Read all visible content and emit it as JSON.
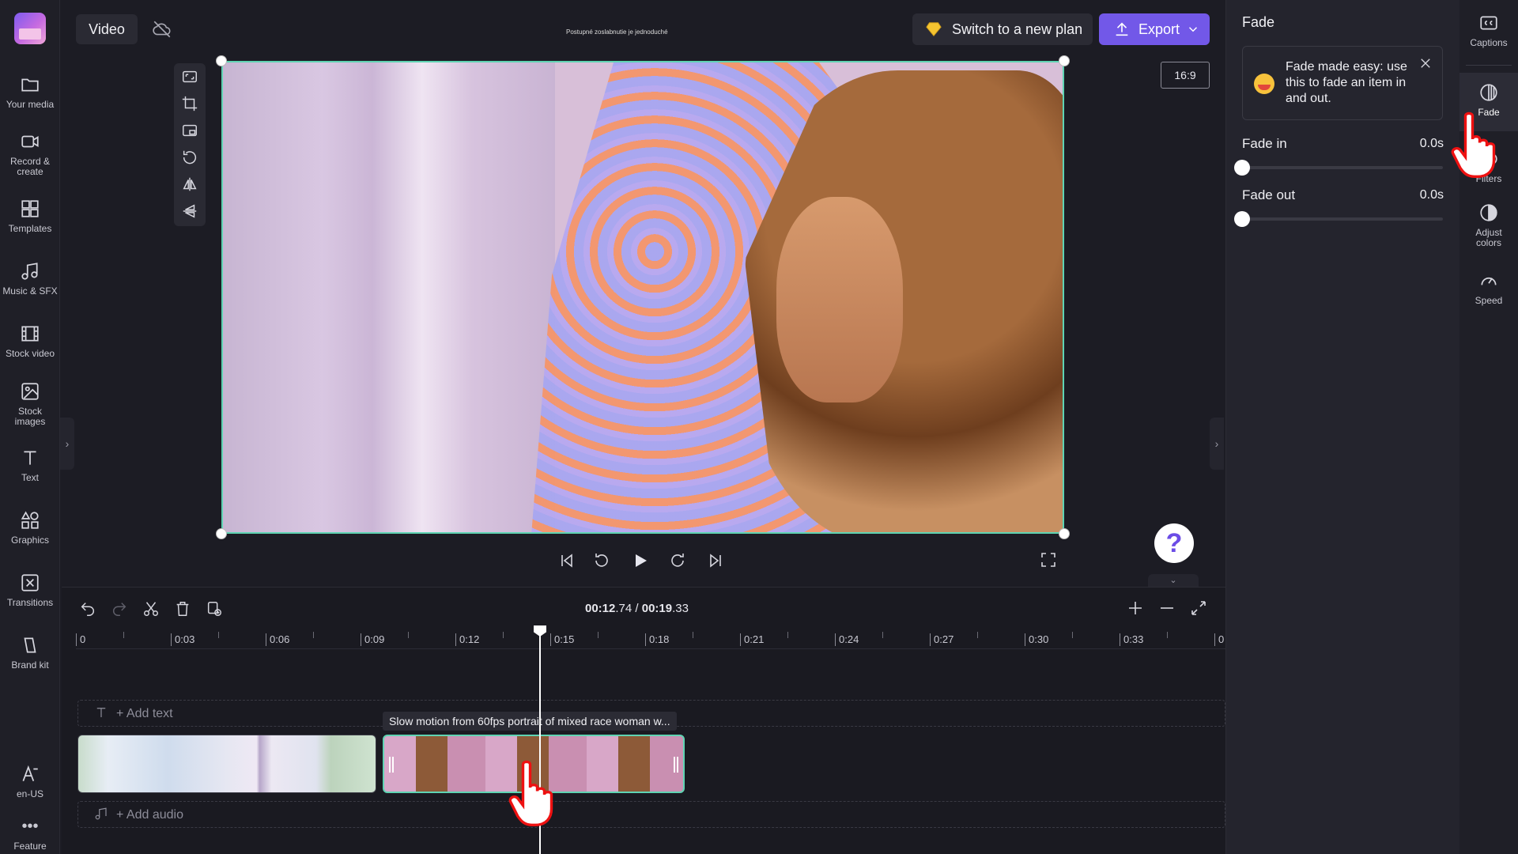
{
  "sidebar": {
    "items": [
      {
        "label": "Your media",
        "icon": "folder-icon"
      },
      {
        "label": "Record & create",
        "icon": "camera-icon"
      },
      {
        "label": "Templates",
        "icon": "templates-icon"
      },
      {
        "label": "Music & SFX",
        "icon": "music-icon"
      },
      {
        "label": "Stock video",
        "icon": "film-icon"
      },
      {
        "label": "Stock images",
        "icon": "image-icon"
      },
      {
        "label": "Text",
        "icon": "text-icon"
      },
      {
        "label": "Graphics",
        "icon": "shapes-icon"
      },
      {
        "label": "Transitions",
        "icon": "transition-icon"
      },
      {
        "label": "Brand kit",
        "icon": "brand-icon"
      }
    ],
    "bottom": [
      {
        "label": "en-US",
        "icon": "language-icon"
      },
      {
        "label": "Feature",
        "icon": "more-icon"
      }
    ]
  },
  "header": {
    "tab_label": "Video",
    "project_title": "Postupné zoslabnutie je jednoduché",
    "plan_label": "Switch to a new plan",
    "export_label": "Export",
    "accent": "#7258e8"
  },
  "preview": {
    "aspect_ratio": "16:9",
    "selection_color": "#5fd4b3"
  },
  "timeline": {
    "current_time": "00:12",
    "current_frac": ".74",
    "separator": " / ",
    "total_time": "00:19",
    "total_frac": ".33",
    "ruler": [
      "0",
      "0:03",
      "0:06",
      "0:09",
      "0:12",
      "0:15",
      "0:18",
      "0:21",
      "0:24",
      "0:27",
      "0:30",
      "0:33",
      "0"
    ],
    "add_text": "+ Add text",
    "add_audio": "+ Add audio",
    "clip_tooltip": "Slow motion from 60fps portrait of mixed race woman w..."
  },
  "panel": {
    "title": "Fade",
    "tip": "Fade made easy: use this to fade an item in and out.",
    "fade_in_label": "Fade in",
    "fade_in_value": "0.0s",
    "fade_in_fraction": 0,
    "fade_out_label": "Fade out",
    "fade_out_value": "0.0s",
    "fade_out_fraction": 0
  },
  "right_rail": {
    "items": [
      {
        "label": "Captions",
        "icon": "captions-icon"
      },
      {
        "label": "Fade",
        "icon": "fade-icon",
        "active": true
      },
      {
        "label": "Filters",
        "icon": "filters-icon"
      },
      {
        "label": "Adjust colors",
        "icon": "adjust-icon"
      },
      {
        "label": "Speed",
        "icon": "speed-icon"
      }
    ]
  }
}
